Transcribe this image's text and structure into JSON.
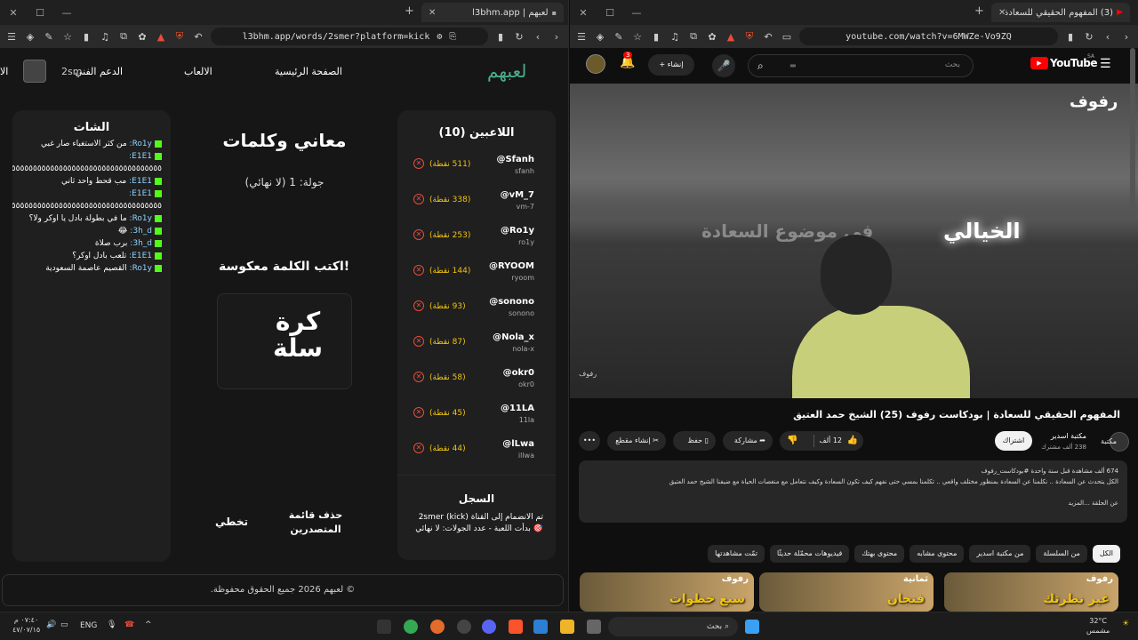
{
  "left_window": {
    "tab_title": "لعبهم | l3bhm.app",
    "url": "l3bhm.app/words/2smer?platform=kick",
    "nav": {
      "logo": "لعبهم",
      "home": "الصفحة الرئيسية",
      "games": "الالعاب",
      "support": "الدعم الفني",
      "extra": "الا",
      "user": "2sm"
    },
    "chat": {
      "title": "الشات",
      "lines": [
        {
          "user": "Ro1y:",
          "text": "من كثر الاستغباء صار غبي"
        },
        {
          "user": "E1E1:",
          "text": ""
        },
        {
          "user": "",
          "text": "٥٥٥٥٥٥٥٥٥٥٥٥٥٥٥٥٥٥٥٥٥٥٥٥٥٥٥٥٥٥٥٥٥٥٥٥٥٥٥٥"
        },
        {
          "user": "E1E1:",
          "text": "مب قحط واحد ثاني"
        },
        {
          "user": "E1E1:",
          "text": ""
        },
        {
          "user": "",
          "text": "٥٥٥٥٥٥٥٥٥٥٥٥٥٥٥٥٥٥٥٥٥٥٥٥٥٥٥٥٥٥٥٥٥٥٥٥٥٥٥٥"
        },
        {
          "user": "Ro1y:",
          "text": "ما في بطولة بادل يا اوكر ولا؟"
        },
        {
          "user": "3h_d:",
          "text": "😂"
        },
        {
          "user": "3h_d:",
          "text": "برب صلاة"
        },
        {
          "user": "E1E1:",
          "text": "تلعب بادل اوكر؟"
        },
        {
          "user": "Ro1y:",
          "text": "القصيم عاصمة السعودية"
        }
      ]
    },
    "game": {
      "title": "معاني وكلمات",
      "round": "جولة: 1 (لا نهائي)",
      "prompt": "اكتب الكلمة معكوسة!",
      "word_line1": "كرة",
      "word_line2": "سلة",
      "skip": "تخطي",
      "clear_board": "حذف قائمة المتصدرين"
    },
    "players": {
      "title": "اللاعبين (10)",
      "list": [
        {
          "name": "@Sfanh",
          "sub": "sfanh",
          "points": "(511 نقطة)"
        },
        {
          "name": "@vM_7",
          "sub": "vm-7",
          "points": "(338 نقطة)"
        },
        {
          "name": "@Ro1y",
          "sub": "ro1y",
          "points": "(253 نقطة)"
        },
        {
          "name": "@RYOOM",
          "sub": "ryoom",
          "points": "(144 نقطة)"
        },
        {
          "name": "@sonono",
          "sub": "sonono",
          "points": "(93 نقطة)"
        },
        {
          "name": "@Nola_x",
          "sub": "nola-x",
          "points": "(87 نقطة)"
        },
        {
          "name": "@okr0",
          "sub": "okr0",
          "points": "(58 نقطة)"
        },
        {
          "name": "@11LA",
          "sub": "11la",
          "points": "(45 نقطة)"
        },
        {
          "name": "@lLwa",
          "sub": "illwa",
          "points": "(44 نقطة)"
        }
      ]
    },
    "log": {
      "title": "السجل",
      "line1": "تم الانضمام إلى القناة (kick) 2smer",
      "line2": "🎯 بدأت اللعبة - عدد الجولات: لا نهائي"
    },
    "footer": "© لعبهم 2026 جميع الحقوق محفوظة."
  },
  "right_window": {
    "tab_title": "(3) المفهوم الحقيقي للسعادة |",
    "url": "youtube.com/watch?v=6MWZe-Vo9ZQ",
    "yt": {
      "logo": "YouTube",
      "region": "SA",
      "search_placeholder": "بحث",
      "create": "إنشاء",
      "notif_count": "3"
    },
    "video": {
      "watermark": "رفوف",
      "overlay_text": "الخيالي",
      "overlay_text2": "في موضوع السعادة",
      "corner_mark": "رفوف",
      "title": "المفهوم الحقيقي للسعادة | بودكاست رفوف (25) الشيخ حمد العتيق",
      "channel": "مكتبة اسدير",
      "subs": "238 ألف مشترك",
      "subscribe": "اشتراك",
      "likes": "12 ألف",
      "share": "مشاركة",
      "save": "حفظ",
      "clip": "إنشاء مقطع",
      "views": "674 ألف مشاهدة  قبل سنة واحدة  #بودكاست_رفوف",
      "desc": "الكل يتحدث عن السعادة .. نكلمنا عن السعادة بمنظور مختلف واقعي .. تكلمنا بمسي حتى نفهم كيف تكون السعادة وكيف نتعامل مع منغصات الحياة مع ضيفنا الشيخ حمد العتيق",
      "episode": "عن الحلقة",
      "more": "...المزيد",
      "channel_short": "مكتبة"
    },
    "chips": [
      "الكل",
      "من السلسلة",
      "من مكتبة اسدير",
      "محتوى مشابه",
      "محتوى بهتك",
      "فيديوهات محمّلة حديثًا",
      "تمّت مشاهدتها"
    ],
    "thumbs": [
      {
        "text": "غير نظرتك",
        "tag": "رفوف"
      },
      {
        "text": "فنجان",
        "tag": "ثمانية"
      },
      {
        "text": "سبع خطوات",
        "tag": "رفوف"
      }
    ]
  },
  "taskbar": {
    "time": "٠٧:٤٠ م",
    "date": "٤٧/٠٧/١٥",
    "lang": "ENG",
    "search": "بحث",
    "weather_temp": "32°C",
    "weather_text": "مشمس"
  }
}
